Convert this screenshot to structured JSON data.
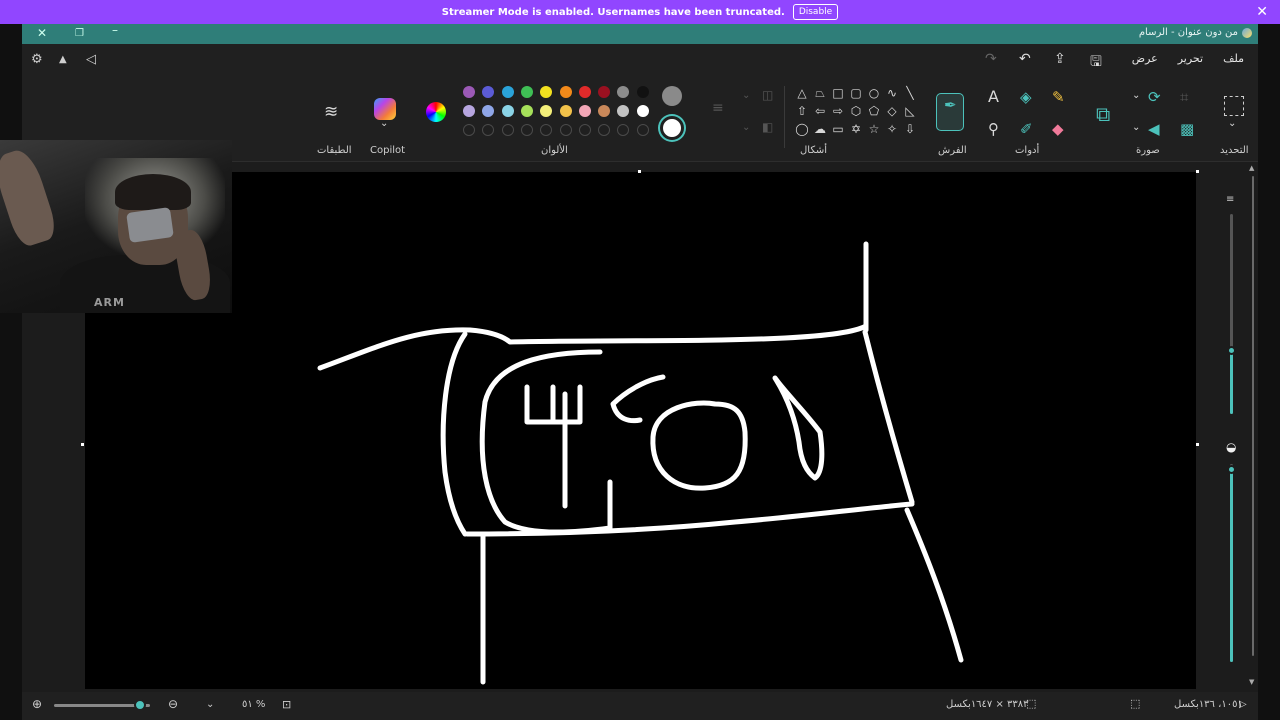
{
  "banner": {
    "message": "Streamer Mode is enabled. Usernames have been truncated.",
    "button": "Disable",
    "close": "✕"
  },
  "window": {
    "title": "من دون عنوان - الرسام"
  },
  "menu": {
    "items": [
      "ملف",
      "تحرير",
      "عرض"
    ]
  },
  "ribbon": {
    "groups": {
      "selection": "التحديد",
      "image": "صورة",
      "tools": "أدوات",
      "brushes": "الفرش",
      "shapes": "أشكال",
      "colors": "الألوان",
      "copilot": "Copilot",
      "layers": "الطبقات"
    },
    "palette_row1": [
      "#9b59b6",
      "#5b5bd6",
      "#2aa3d9",
      "#3fbf55",
      "#f2e01f",
      "#f28a1a",
      "#e02a2a",
      "#9a1020",
      "#8c8c8c",
      "#111111"
    ],
    "palette_row2": [
      "#b7a6e0",
      "#8fa6e8",
      "#8ad3e6",
      "#a6e05a",
      "#f4ef7a",
      "#f2c24a",
      "#f2a6b6",
      "#c9885a",
      "#c2c2c2",
      "#ffffff"
    ],
    "color1": "#8a8a8a",
    "color2": "#ffffff"
  },
  "webcam": {
    "shirt_text": "ARM"
  },
  "status": {
    "cursor_pos": "١٠٥١، ١٣٦بكسل",
    "canvas_size": "٣٣٨٣ × ١٦٤٧بكسل",
    "zoom": "٥١ %",
    "zoom_level": 0.9
  },
  "colors": {
    "accent": "#4cc2bb",
    "banner": "#9146ff",
    "titlebar": "#2f7e79"
  }
}
